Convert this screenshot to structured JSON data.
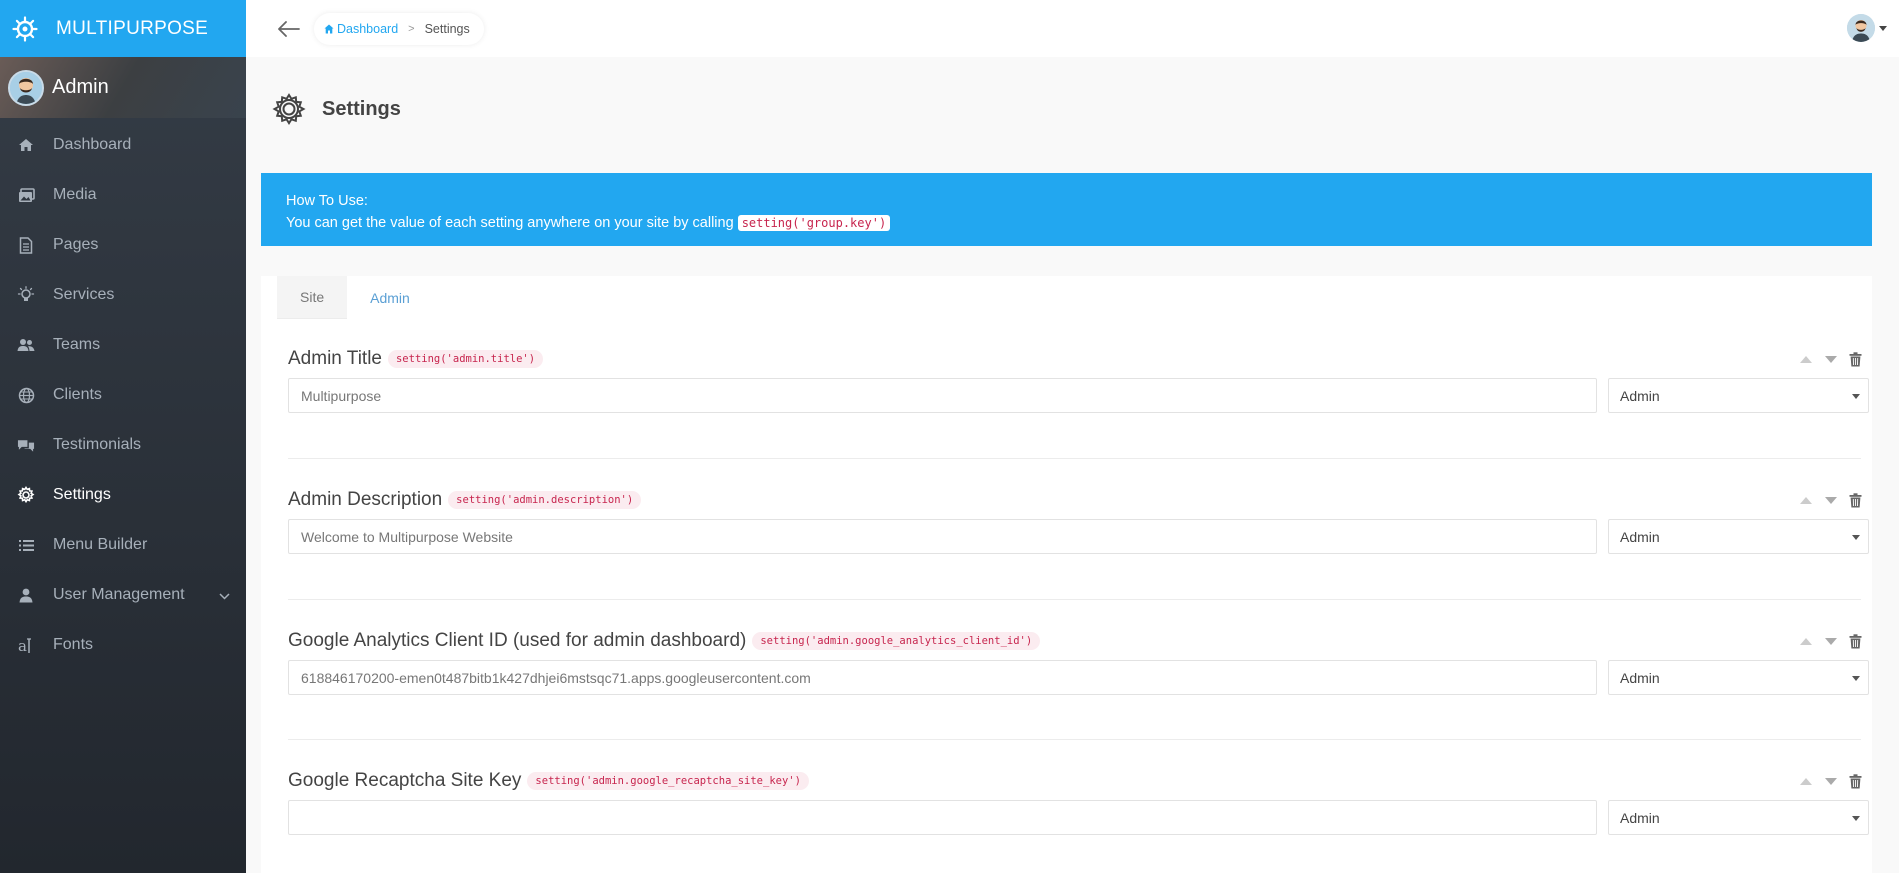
{
  "brand": {
    "name": "MULTIPURPOSE",
    "color": "#22A7F0"
  },
  "profile": {
    "name": "Admin"
  },
  "sidebar": {
    "items": [
      {
        "label": "Dashboard",
        "icon": "home-icon"
      },
      {
        "label": "Media",
        "icon": "images-icon"
      },
      {
        "label": "Pages",
        "icon": "file-icon"
      },
      {
        "label": "Services",
        "icon": "lightbulb-icon"
      },
      {
        "label": "Teams",
        "icon": "people-icon"
      },
      {
        "label": "Clients",
        "icon": "globe-icon"
      },
      {
        "label": "Testimonials",
        "icon": "chat-bubbles-icon"
      },
      {
        "label": "Settings",
        "icon": "gear-icon",
        "active": true
      },
      {
        "label": "Menu Builder",
        "icon": "list-icon"
      },
      {
        "label": "User Management",
        "icon": "person-icon",
        "has_children": true
      },
      {
        "label": "Fonts",
        "icon": "font-icon"
      }
    ]
  },
  "breadcrumb": {
    "home": "Dashboard",
    "current": "Settings"
  },
  "page": {
    "title": "Settings"
  },
  "alert": {
    "title": "How To Use:",
    "text": "You can get the value of each setting anywhere on your site by calling",
    "code": "setting('group.key')"
  },
  "tabs": [
    {
      "label": "Site",
      "active": true
    },
    {
      "label": "Admin",
      "active": false
    }
  ],
  "settings": [
    {
      "label": "Admin Title",
      "key": "setting('admin.title')",
      "value": "Multipurpose",
      "group": "Admin"
    },
    {
      "label": "Admin Description",
      "key": "setting('admin.description')",
      "value": "Welcome to Multipurpose Website",
      "group": "Admin"
    },
    {
      "label": "Google Analytics Client ID (used for admin dashboard)",
      "key": "setting('admin.google_analytics_client_id')",
      "value": "618846170200-emen0t487bitb1k427dhjei6mstsqc71.apps.googleusercontent.com",
      "group": "Admin"
    },
    {
      "label": "Google Recaptcha Site Key",
      "key": "setting('admin.google_recaptcha_site_key')",
      "value": "",
      "group": "Admin"
    }
  ]
}
